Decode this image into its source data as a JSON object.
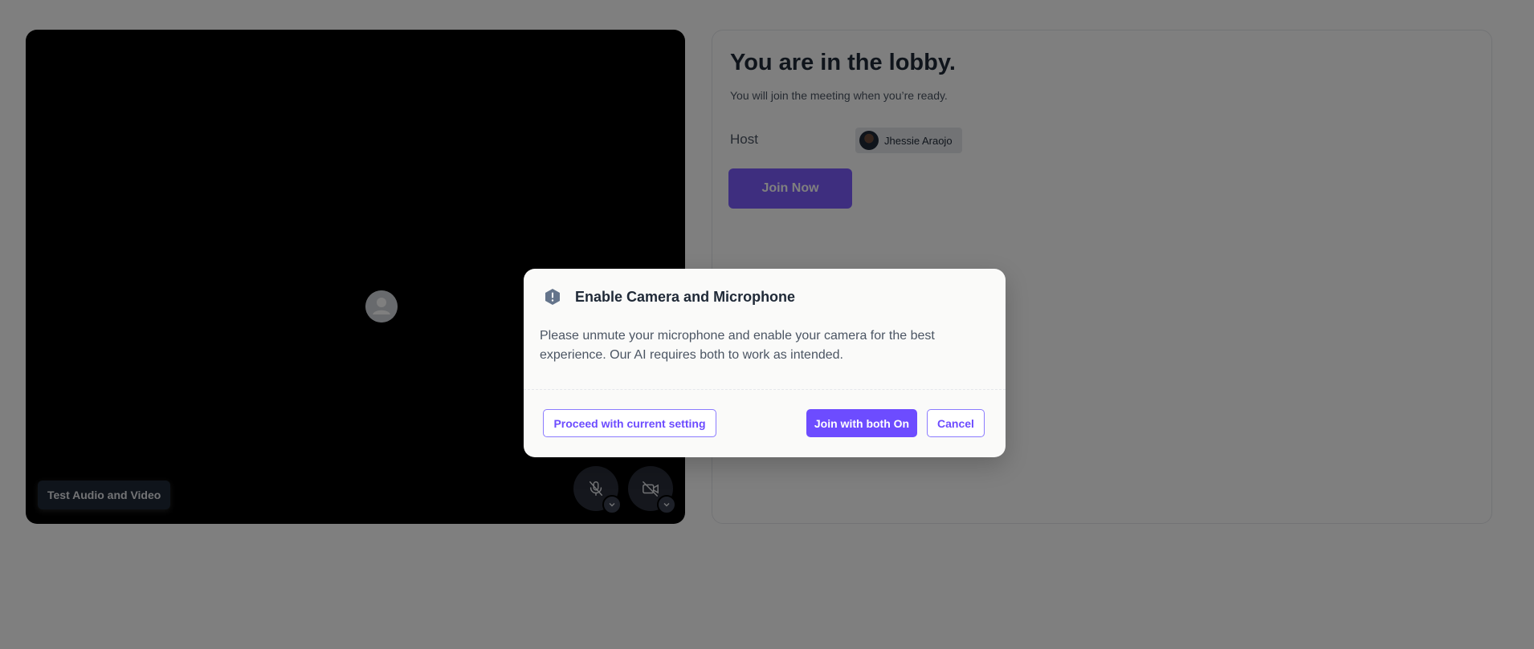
{
  "video_preview": {
    "test_button_label": "Test Audio and Video",
    "mic_state": "muted",
    "camera_state": "off"
  },
  "lobby": {
    "title": "You are in the lobby.",
    "subtitle": "You will join the meeting when you’re ready.",
    "host_label": "Host",
    "host_name": "Jhessie Araojo",
    "join_button_label": "Join Now"
  },
  "modal": {
    "title": "Enable Camera and Microphone",
    "body": "Please unmute your microphone and enable your camera for the best experience. Our AI requires both to work as intended.",
    "proceed_label": "Proceed with current setting",
    "join_both_label": "Join with both On",
    "cancel_label": "Cancel"
  },
  "colors": {
    "accent": "#6d4cff",
    "overlay": "rgba(0,0,0,0.5)",
    "text_dark": "#1f2937",
    "text_muted": "#4b5563"
  },
  "icons": [
    "user-silhouette-icon",
    "mic-off-icon",
    "video-off-icon",
    "chevron-down-icon",
    "alert-hexagon-icon"
  ]
}
